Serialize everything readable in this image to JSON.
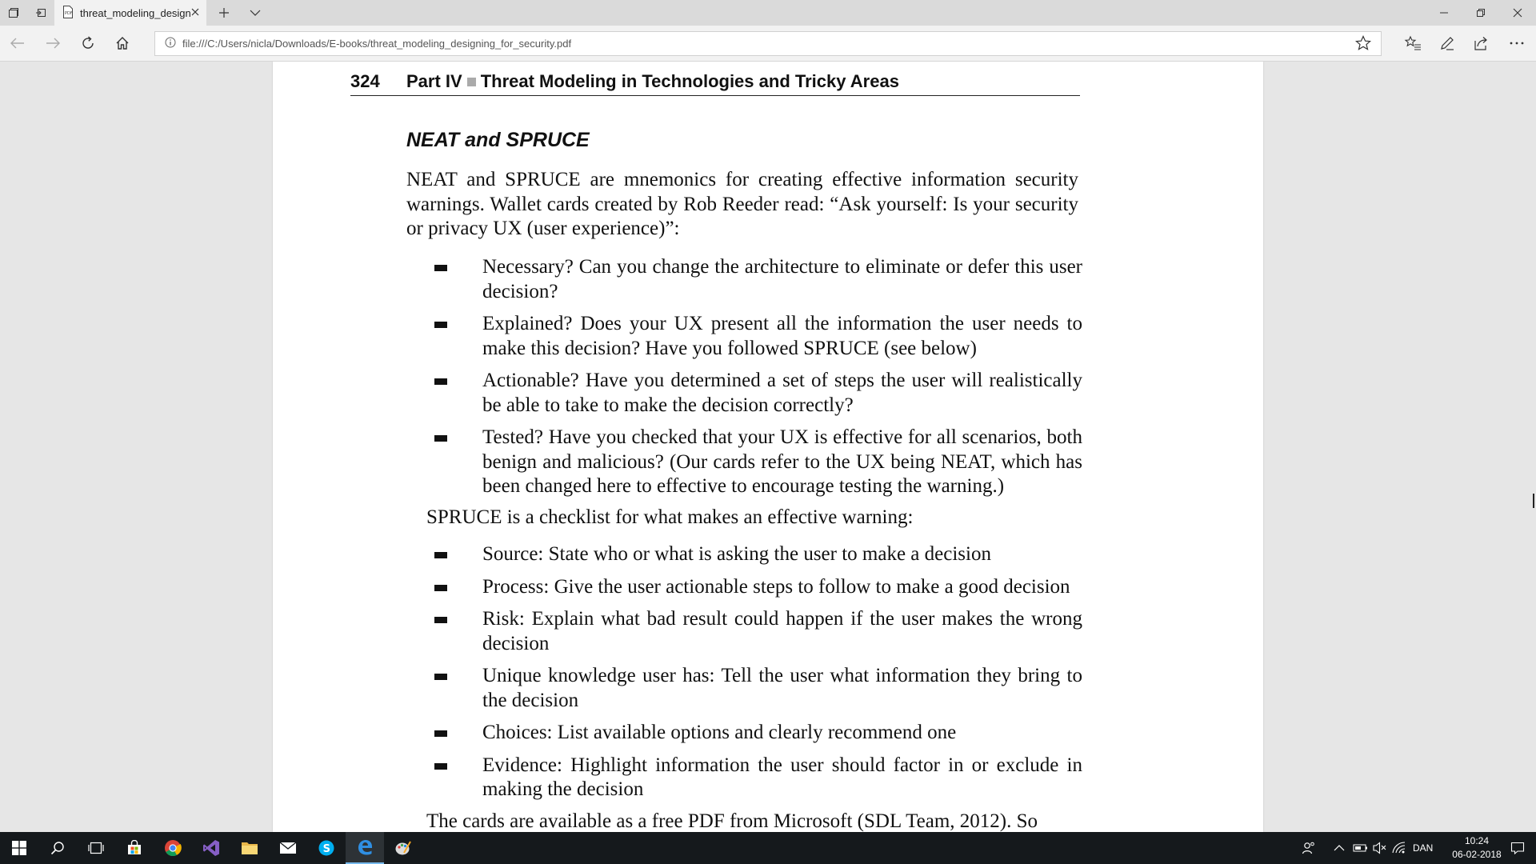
{
  "browser": {
    "tab_title": "threat_modeling_designi",
    "url": "file:///C:/Users/nicla/Downloads/E-books/threat_modeling_designing_for_security.pdf"
  },
  "document": {
    "page_number": "324",
    "part_label": "Part IV",
    "running_title": "Threat Modeling in Technologies and Tricky Areas",
    "section_heading": "NEAT and SPRUCE",
    "intro": "NEAT and SPRUCE are mnemonics for creating effective information security warnings. Wallet cards created by Rob Reeder read: “Ask yourself: Is your security or privacy UX (user experience)”:",
    "neat_items": [
      "Necessary? Can you change the architecture to eliminate or defer this user decision?",
      "Explained? Does your UX present all the information the user needs to make this decision? Have you followed SPRUCE (see below)",
      "Actionable? Have you determined a set of steps the user will realistically be able to take to make the decision correctly?",
      "Tested? Have you checked that your UX is effective for all scenarios, both benign and malicious? (Our cards refer to the UX being NEAT, which has been changed here to effective to encourage testing the warning.)"
    ],
    "spruce_intro": "SPRUCE is a checklist for what makes an effective warning:",
    "spruce_items": [
      "Source: State who or what is asking the user to make a decision",
      "Process: Give the user actionable steps to follow to make a good decision",
      "Risk: Explain what bad result could happen if the user makes the wrong decision",
      "Unique knowledge user has: Tell the user what information they bring to the decision",
      "Choices: List available options and clearly recommend one",
      "Evidence: Highlight information the user should factor in or exclude in making the decision"
    ],
    "closing_partial": "The cards are available as a free PDF from Microsoft (SDL Team, 2012). So"
  },
  "taskbar": {
    "language": "DAN",
    "time": "10:24",
    "date": "06-02-2018"
  },
  "colors": {
    "taskbar_bg": "#15191c",
    "edge_blue": "#0078d7",
    "active_indicator": "#76b9ed"
  }
}
